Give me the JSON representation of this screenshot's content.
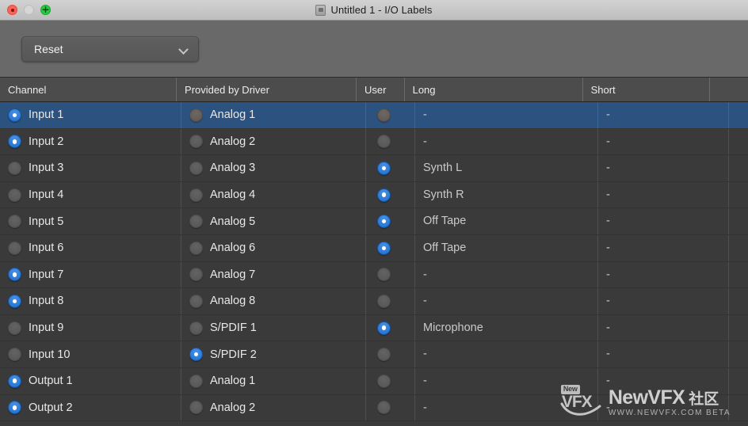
{
  "window": {
    "title": "Untitled 1 - I/O Labels",
    "doc_icon": "document-icon",
    "controls": {
      "close": "close-button",
      "minimize": "minimize-button",
      "maximize": "maximize-button"
    }
  },
  "toolbar": {
    "preset_label": "Reset",
    "chevron": "chevron-down-icon"
  },
  "table": {
    "columns": [
      {
        "key": "channel",
        "label": "Channel"
      },
      {
        "key": "driver",
        "label": "Provided by Driver"
      },
      {
        "key": "user",
        "label": "User"
      },
      {
        "key": "long",
        "label": "Long"
      },
      {
        "key": "short",
        "label": "Short"
      }
    ],
    "rows": [
      {
        "channel": "Input 1",
        "channel_radio": "on",
        "driver": "Analog 1",
        "driver_radio": "off",
        "user_radio": "off",
        "long": "-",
        "short": "-",
        "selected": true
      },
      {
        "channel": "Input 2",
        "channel_radio": "on",
        "driver": "Analog 2",
        "driver_radio": "off",
        "user_radio": "off",
        "long": "-",
        "short": "-",
        "selected": false
      },
      {
        "channel": "Input 3",
        "channel_radio": "off",
        "driver": "Analog 3",
        "driver_radio": "off",
        "user_radio": "on",
        "long": "Synth L",
        "short": "-",
        "selected": false
      },
      {
        "channel": "Input 4",
        "channel_radio": "off",
        "driver": "Analog 4",
        "driver_radio": "off",
        "user_radio": "on",
        "long": "Synth R",
        "short": "-",
        "selected": false
      },
      {
        "channel": "Input 5",
        "channel_radio": "off",
        "driver": "Analog 5",
        "driver_radio": "off",
        "user_radio": "on",
        "long": "Off Tape",
        "short": "-",
        "selected": false
      },
      {
        "channel": "Input 6",
        "channel_radio": "off",
        "driver": "Analog 6",
        "driver_radio": "off",
        "user_radio": "on",
        "long": "Off Tape",
        "short": "-",
        "selected": false
      },
      {
        "channel": "Input 7",
        "channel_radio": "on",
        "driver": "Analog 7",
        "driver_radio": "off",
        "user_radio": "off",
        "long": "-",
        "short": "-",
        "selected": false
      },
      {
        "channel": "Input 8",
        "channel_radio": "on",
        "driver": "Analog 8",
        "driver_radio": "off",
        "user_radio": "off",
        "long": "-",
        "short": "-",
        "selected": false
      },
      {
        "channel": "Input 9",
        "channel_radio": "off",
        "driver": "S/PDIF 1",
        "driver_radio": "off",
        "user_radio": "on",
        "long": "Microphone",
        "short": "-",
        "selected": false
      },
      {
        "channel": "Input 10",
        "channel_radio": "off",
        "driver": "S/PDIF 2",
        "driver_radio": "on",
        "user_radio": "off",
        "long": "-",
        "short": "-",
        "selected": false
      },
      {
        "channel": "Output 1",
        "channel_radio": "on",
        "driver": "Analog 1",
        "driver_radio": "off",
        "user_radio": "off",
        "long": "-",
        "short": "-",
        "selected": false
      },
      {
        "channel": "Output 2",
        "channel_radio": "on",
        "driver": "Analog 2",
        "driver_radio": "off",
        "user_radio": "off",
        "long": "-",
        "short": "-",
        "selected": false
      }
    ]
  },
  "scrollbar": {
    "name": "vertical-scrollbar",
    "thumb": "scrollbar-thumb"
  },
  "watermark": {
    "badge": "New",
    "logo_text": "VFX",
    "name": "NewVFX",
    "cn": "社区",
    "url": "WWW.NEWVFX.COM BETA"
  },
  "colors": {
    "selection_blue": "#2c5280",
    "radio_on_blue": "#1d6fd0",
    "body_bg": "#3a3a3a",
    "toolbar_bg": "#696969",
    "header_bg": "#4c4c4c",
    "titlebar_bg": "#c8c8c8"
  }
}
